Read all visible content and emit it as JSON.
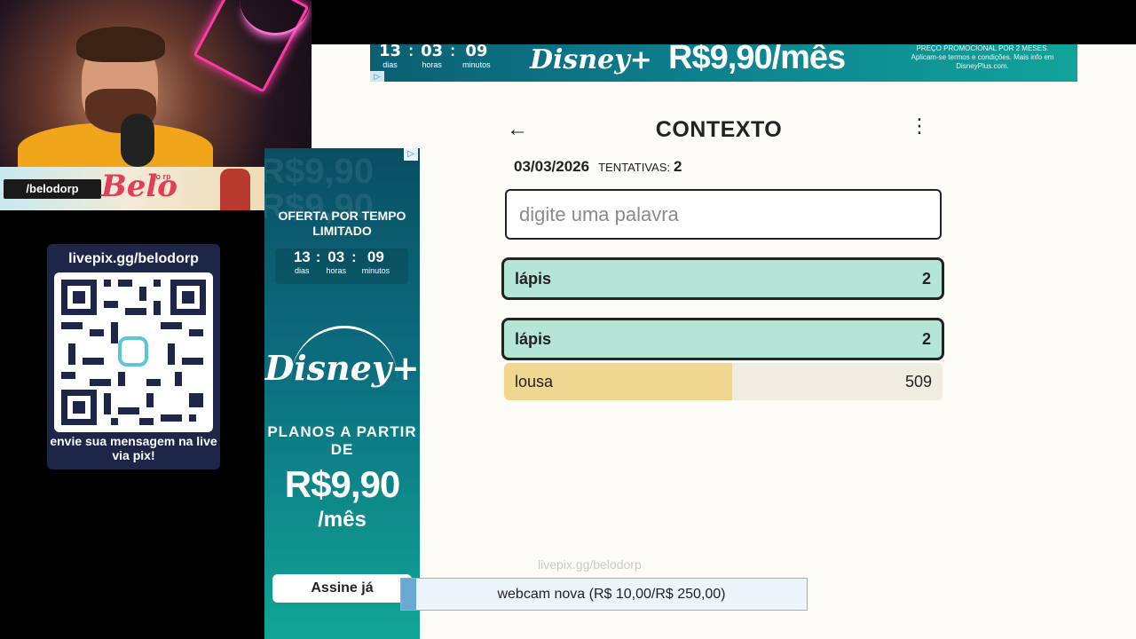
{
  "top_ad": {
    "timer": [
      {
        "value": "13",
        "label": "dias"
      },
      {
        "value": "03",
        "label": "horas"
      },
      {
        "value": "09",
        "label": "minutos"
      }
    ],
    "brand": "Disney+",
    "price": "R$9,90/mês",
    "fine_print": "PREÇO PROMOCIONAL POR 2 MESES. Aplicam-se termos e condições. Mais info em DisneyPlus.com."
  },
  "game": {
    "title": "CONTEXTO",
    "back_icon": "←",
    "menu_icon": "⋮",
    "date": "03/03/2026",
    "attempts_label": "TENTATIVAS:",
    "attempts_value": "2",
    "input_placeholder": "digite uma palavra",
    "last_guess": {
      "word": "lápis",
      "rank": "2"
    },
    "guesses": [
      {
        "word": "lápis",
        "rank": "2",
        "fill_fraction": 1.0
      },
      {
        "word": "lousa",
        "rank": "509",
        "fill_fraction": 0.52
      }
    ]
  },
  "side_ad": {
    "bg_text": "R$9,90",
    "offer": "OFERTA POR TEMPO LIMITADO",
    "timer": [
      {
        "value": "13",
        "label": "dias"
      },
      {
        "value": "03",
        "label": "horas"
      },
      {
        "value": "09",
        "label": "minutos"
      }
    ],
    "brand": "Disney+",
    "plans": "PLANOS A PARTIR DE",
    "price": "R$9,90",
    "per_month": "/mês",
    "cta": "Assine já"
  },
  "stream": {
    "banner_handle": "/belodorp",
    "banner_script": "Belo",
    "banner_small": "do rp",
    "pix_url": "livepix.gg/belodorp",
    "pix_message": "envie sua mensagem na live via pix!",
    "watermark": "livepix.gg/belodorp",
    "donation_goal": "webcam nova (R$ 10,00/R$ 250,00)"
  },
  "colors": {
    "correct_row": "#b5e5d6",
    "mid_row": "#efd791",
    "page_bg": "#fdfbf5"
  }
}
